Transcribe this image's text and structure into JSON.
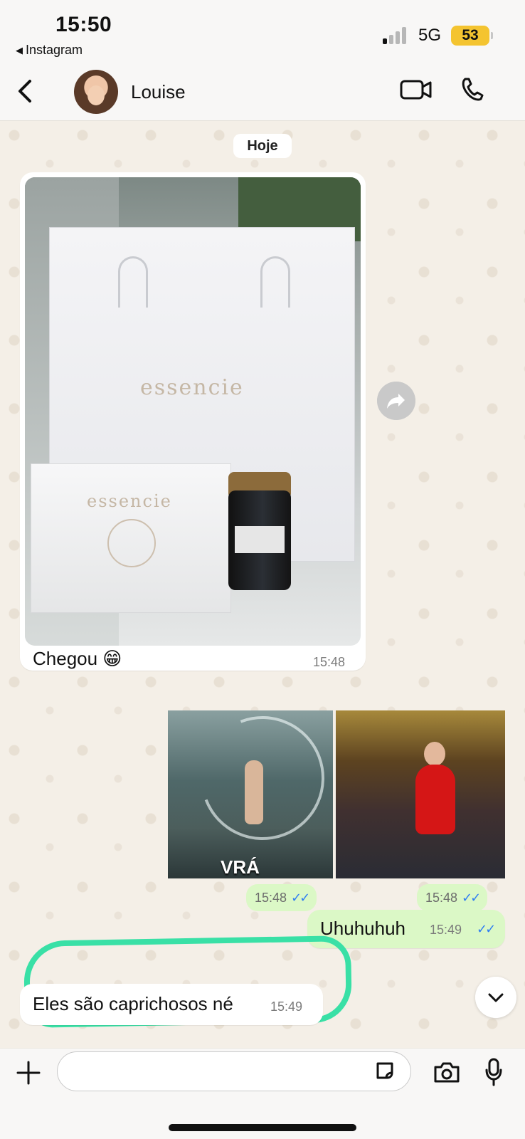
{
  "status_bar": {
    "time": "15:50",
    "back_app": "Instagram",
    "network": "5G",
    "battery": "53"
  },
  "header": {
    "contact_name": "Louise"
  },
  "chat": {
    "date_label": "Hoje",
    "incoming_photo": {
      "caption": "Chegou 😁",
      "time": "15:48"
    },
    "gifs": [
      {
        "caption": "VRÁ",
        "time": "15:48"
      },
      {
        "caption": "",
        "time": "15:48"
      }
    ],
    "outgoing_text": {
      "text": "Uhuhuhuh",
      "time": "15:49"
    },
    "incoming_text": {
      "text": "Eles são caprichosos né",
      "time": "15:49"
    }
  },
  "composer": {
    "placeholder": ""
  },
  "colors": {
    "chat_background": "#f4efe7",
    "outgoing_bubble": "#dbf8c6",
    "incoming_bubble": "#ffffff",
    "read_ticks": "#2f7ef2",
    "highlight": "#39e0a6"
  }
}
